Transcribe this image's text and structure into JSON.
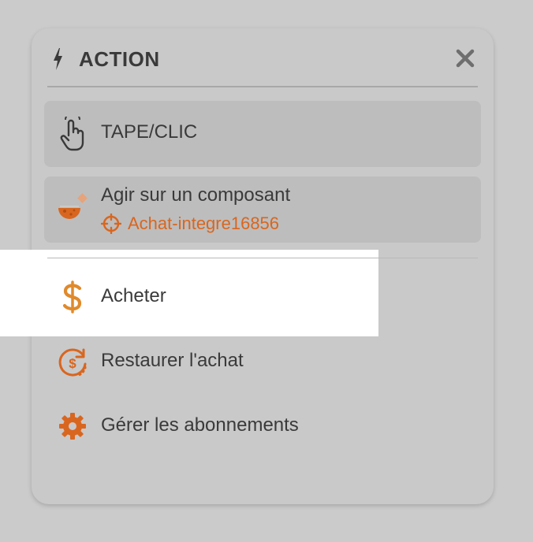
{
  "header": {
    "title": "ACTION",
    "icon": "bolt-icon",
    "close_icon": "close-icon"
  },
  "cards": {
    "tap": {
      "label": "TAPE/CLIC",
      "icon": "pointer-hand-icon"
    },
    "agir": {
      "label": "Agir sur un composant",
      "target": "Achat-integre16856",
      "icon": "component-icon",
      "target_icon": "crosshair-icon"
    }
  },
  "actions": [
    {
      "label": "Acheter",
      "icon": "dollar-icon"
    },
    {
      "label": "Restaurer l'achat",
      "icon": "restore-purchase-icon"
    },
    {
      "label": "Gérer les abonnements",
      "icon": "gear-icon"
    }
  ],
  "colors": {
    "accent": "#d9661f",
    "text": "#3a3a3a",
    "panel": "#c9c9c9",
    "card": "#bdbdbd",
    "highlight": "#ffffff"
  }
}
